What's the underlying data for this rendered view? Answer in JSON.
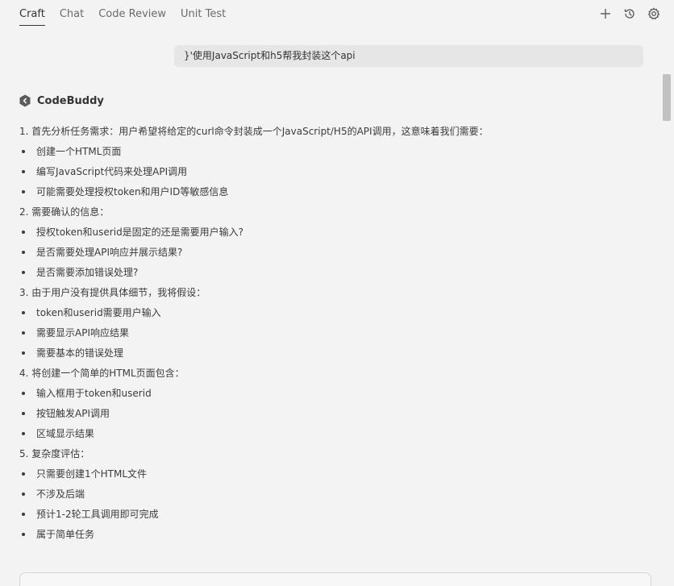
{
  "header": {
    "tabs": [
      {
        "label": "Craft",
        "active": true
      },
      {
        "label": "Chat",
        "active": false
      },
      {
        "label": "Code Review",
        "active": false
      },
      {
        "label": "Unit Test",
        "active": false
      }
    ],
    "actions": [
      "plus-icon",
      "history-icon",
      "settings-icon"
    ]
  },
  "user_message": {
    "text": "}'使用JavaScript和h5帮我封装这个api"
  },
  "assistant": {
    "name": "CodeBuddy",
    "lines": [
      {
        "type": "num",
        "text": "1. 首先分析任务需求：用户希望将给定的curl命令封装成一个JavaScript/H5的API调用，这意味着我们需要："
      },
      {
        "type": "bullet",
        "text": "创建一个HTML页面"
      },
      {
        "type": "bullet",
        "text": "编写JavaScript代码来处理API调用"
      },
      {
        "type": "bullet",
        "text": "可能需要处理授权token和用户ID等敏感信息"
      },
      {
        "type": "num",
        "text": "2. 需要确认的信息："
      },
      {
        "type": "bullet",
        "text": "授权token和userid是固定的还是需要用户输入?"
      },
      {
        "type": "bullet",
        "text": "是否需要处理API响应并展示结果?"
      },
      {
        "type": "bullet",
        "text": "是否需要添加错误处理?"
      },
      {
        "type": "num",
        "text": "3. 由于用户没有提供具体细节，我将假设："
      },
      {
        "type": "bullet",
        "text": "token和userid需要用户输入"
      },
      {
        "type": "bullet",
        "text": "需要显示API响应结果"
      },
      {
        "type": "bullet",
        "text": "需要基本的错误处理"
      },
      {
        "type": "num",
        "text": "4. 将创建一个简单的HTML页面包含："
      },
      {
        "type": "bullet",
        "text": "输入框用于token和userid"
      },
      {
        "type": "bullet",
        "text": "按钮触发API调用"
      },
      {
        "type": "bullet",
        "text": "区域显示结果"
      },
      {
        "type": "num",
        "text": "5. 复杂度评估："
      },
      {
        "type": "bullet",
        "text": "只需要创建1个HTML文件"
      },
      {
        "type": "bullet",
        "text": "不涉及后端"
      },
      {
        "type": "bullet",
        "text": "预计1-2轮工具调用即可完成"
      },
      {
        "type": "bullet",
        "text": "属于简单任务"
      }
    ]
  }
}
